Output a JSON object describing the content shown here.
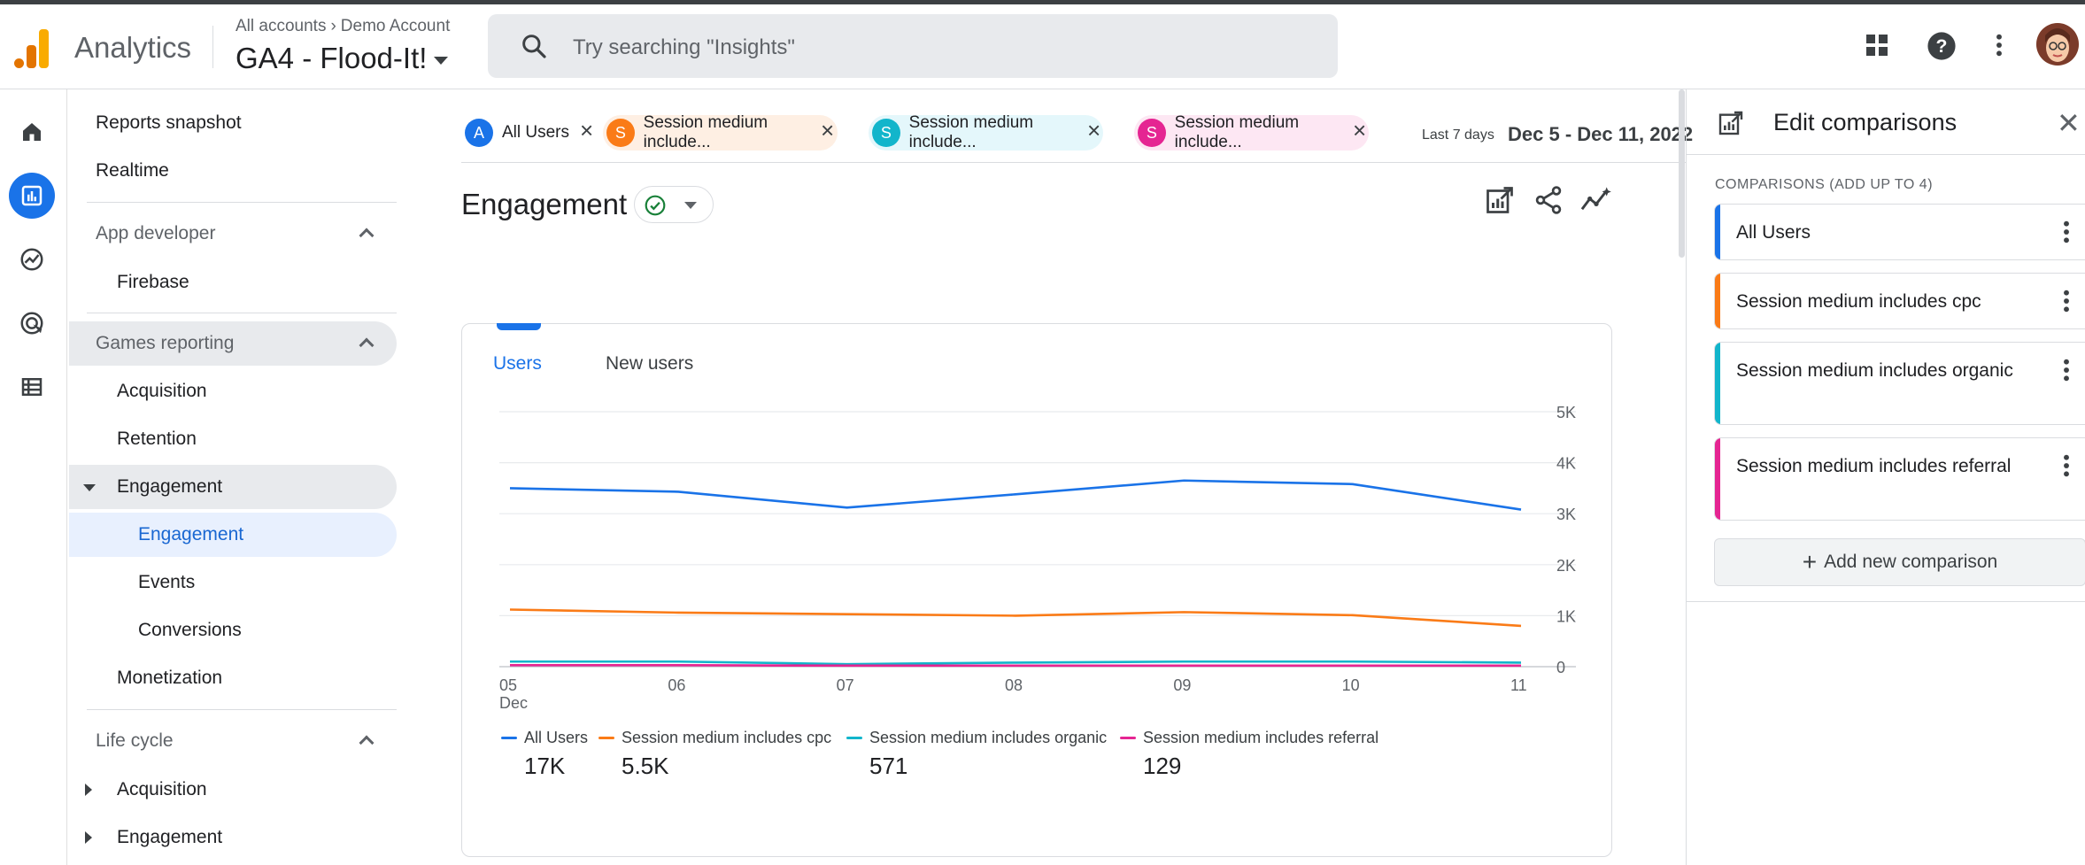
{
  "header": {
    "product": "Analytics",
    "breadcrumb_root": "All accounts",
    "breadcrumb_account": "Demo Account",
    "property": "GA4 - Flood-It!",
    "search_placeholder": "Try searching \"Insights\""
  },
  "nav": {
    "reports_snapshot": "Reports snapshot",
    "realtime": "Realtime",
    "app_developer": "App developer",
    "firebase": "Firebase",
    "games_reporting": "Games reporting",
    "acquisition": "Acquisition",
    "retention": "Retention",
    "engagement": "Engagement",
    "engagement_sub": "Engagement",
    "events": "Events",
    "conversions": "Conversions",
    "monetization": "Monetization",
    "life_cycle": "Life cycle",
    "lc_acquisition": "Acquisition",
    "lc_engagement": "Engagement"
  },
  "chips": [
    {
      "letter": "A",
      "label": "All Users",
      "color": "#1a73e8",
      "bg": "#ffffff"
    },
    {
      "letter": "S",
      "label": "Session medium include...",
      "color": "#fa7b17",
      "bg": "#feefe3"
    },
    {
      "letter": "S",
      "label": "Session medium include...",
      "color": "#12b5cb",
      "bg": "#e4f7fb"
    },
    {
      "letter": "S",
      "label": "Session medium include...",
      "color": "#e52592",
      "bg": "#fde7f3"
    }
  ],
  "date": {
    "preset": "Last 7 days",
    "range": "Dec 5 - Dec 11, 2022"
  },
  "page": {
    "title": "Engagement"
  },
  "tabs": {
    "users": "Users",
    "new_users": "New users"
  },
  "chart_data": {
    "type": "line",
    "title": "",
    "xlabel": "",
    "ylabel": "",
    "x": [
      "05",
      "06",
      "07",
      "08",
      "09",
      "10",
      "11"
    ],
    "x_month_label": "Dec",
    "y_ticks": [
      "5K",
      "4K",
      "3K",
      "2K",
      "1K",
      "0"
    ],
    "ylim": [
      0,
      5000
    ],
    "y_axis_side": "right",
    "series": [
      {
        "name": "All Users",
        "color": "#1a73e8",
        "values": [
          3500,
          3430,
          3120,
          3380,
          3650,
          3580,
          3080
        ],
        "total": "17K"
      },
      {
        "name": "Session medium includes cpc",
        "color": "#fa7b17",
        "values": [
          1120,
          1060,
          1030,
          1000,
          1070,
          1010,
          800
        ],
        "total": "5.5K"
      },
      {
        "name": "Session medium includes organic",
        "color": "#12b5cb",
        "values": [
          100,
          100,
          50,
          80,
          100,
          100,
          80
        ],
        "total": "571"
      },
      {
        "name": "Session medium includes referral",
        "color": "#e52592",
        "values": [
          30,
          30,
          20,
          20,
          20,
          20,
          20
        ],
        "total": "129"
      }
    ]
  },
  "panel": {
    "title": "Edit comparisons",
    "subtitle": "COMPARISONS (ADD UP TO 4)",
    "comparisons": [
      {
        "label": "All Users",
        "color": "#1a73e8"
      },
      {
        "label": "Session medium includes cpc",
        "color": "#fa7b17"
      },
      {
        "label": "Session medium includes organic",
        "color": "#12b5cb"
      },
      {
        "label": "Session medium includes referral",
        "color": "#e52592"
      }
    ],
    "add_label": "Add new comparison"
  }
}
